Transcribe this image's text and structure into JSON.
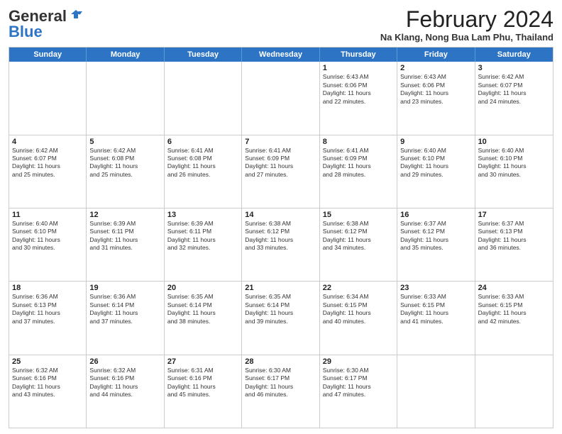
{
  "logo": {
    "general": "General",
    "blue": "Blue"
  },
  "header": {
    "title": "February 2024",
    "location": "Na Klang, Nong Bua Lam Phu, Thailand"
  },
  "weekdays": [
    "Sunday",
    "Monday",
    "Tuesday",
    "Wednesday",
    "Thursday",
    "Friday",
    "Saturday"
  ],
  "weeks": [
    [
      {
        "day": "",
        "info": ""
      },
      {
        "day": "",
        "info": ""
      },
      {
        "day": "",
        "info": ""
      },
      {
        "day": "",
        "info": ""
      },
      {
        "day": "1",
        "info": "Sunrise: 6:43 AM\nSunset: 6:06 PM\nDaylight: 11 hours\nand 22 minutes."
      },
      {
        "day": "2",
        "info": "Sunrise: 6:43 AM\nSunset: 6:06 PM\nDaylight: 11 hours\nand 23 minutes."
      },
      {
        "day": "3",
        "info": "Sunrise: 6:42 AM\nSunset: 6:07 PM\nDaylight: 11 hours\nand 24 minutes."
      }
    ],
    [
      {
        "day": "4",
        "info": "Sunrise: 6:42 AM\nSunset: 6:07 PM\nDaylight: 11 hours\nand 25 minutes."
      },
      {
        "day": "5",
        "info": "Sunrise: 6:42 AM\nSunset: 6:08 PM\nDaylight: 11 hours\nand 25 minutes."
      },
      {
        "day": "6",
        "info": "Sunrise: 6:41 AM\nSunset: 6:08 PM\nDaylight: 11 hours\nand 26 minutes."
      },
      {
        "day": "7",
        "info": "Sunrise: 6:41 AM\nSunset: 6:09 PM\nDaylight: 11 hours\nand 27 minutes."
      },
      {
        "day": "8",
        "info": "Sunrise: 6:41 AM\nSunset: 6:09 PM\nDaylight: 11 hours\nand 28 minutes."
      },
      {
        "day": "9",
        "info": "Sunrise: 6:40 AM\nSunset: 6:10 PM\nDaylight: 11 hours\nand 29 minutes."
      },
      {
        "day": "10",
        "info": "Sunrise: 6:40 AM\nSunset: 6:10 PM\nDaylight: 11 hours\nand 30 minutes."
      }
    ],
    [
      {
        "day": "11",
        "info": "Sunrise: 6:40 AM\nSunset: 6:10 PM\nDaylight: 11 hours\nand 30 minutes."
      },
      {
        "day": "12",
        "info": "Sunrise: 6:39 AM\nSunset: 6:11 PM\nDaylight: 11 hours\nand 31 minutes."
      },
      {
        "day": "13",
        "info": "Sunrise: 6:39 AM\nSunset: 6:11 PM\nDaylight: 11 hours\nand 32 minutes."
      },
      {
        "day": "14",
        "info": "Sunrise: 6:38 AM\nSunset: 6:12 PM\nDaylight: 11 hours\nand 33 minutes."
      },
      {
        "day": "15",
        "info": "Sunrise: 6:38 AM\nSunset: 6:12 PM\nDaylight: 11 hours\nand 34 minutes."
      },
      {
        "day": "16",
        "info": "Sunrise: 6:37 AM\nSunset: 6:12 PM\nDaylight: 11 hours\nand 35 minutes."
      },
      {
        "day": "17",
        "info": "Sunrise: 6:37 AM\nSunset: 6:13 PM\nDaylight: 11 hours\nand 36 minutes."
      }
    ],
    [
      {
        "day": "18",
        "info": "Sunrise: 6:36 AM\nSunset: 6:13 PM\nDaylight: 11 hours\nand 37 minutes."
      },
      {
        "day": "19",
        "info": "Sunrise: 6:36 AM\nSunset: 6:14 PM\nDaylight: 11 hours\nand 37 minutes."
      },
      {
        "day": "20",
        "info": "Sunrise: 6:35 AM\nSunset: 6:14 PM\nDaylight: 11 hours\nand 38 minutes."
      },
      {
        "day": "21",
        "info": "Sunrise: 6:35 AM\nSunset: 6:14 PM\nDaylight: 11 hours\nand 39 minutes."
      },
      {
        "day": "22",
        "info": "Sunrise: 6:34 AM\nSunset: 6:15 PM\nDaylight: 11 hours\nand 40 minutes."
      },
      {
        "day": "23",
        "info": "Sunrise: 6:33 AM\nSunset: 6:15 PM\nDaylight: 11 hours\nand 41 minutes."
      },
      {
        "day": "24",
        "info": "Sunrise: 6:33 AM\nSunset: 6:15 PM\nDaylight: 11 hours\nand 42 minutes."
      }
    ],
    [
      {
        "day": "25",
        "info": "Sunrise: 6:32 AM\nSunset: 6:16 PM\nDaylight: 11 hours\nand 43 minutes."
      },
      {
        "day": "26",
        "info": "Sunrise: 6:32 AM\nSunset: 6:16 PM\nDaylight: 11 hours\nand 44 minutes."
      },
      {
        "day": "27",
        "info": "Sunrise: 6:31 AM\nSunset: 6:16 PM\nDaylight: 11 hours\nand 45 minutes."
      },
      {
        "day": "28",
        "info": "Sunrise: 6:30 AM\nSunset: 6:17 PM\nDaylight: 11 hours\nand 46 minutes."
      },
      {
        "day": "29",
        "info": "Sunrise: 6:30 AM\nSunset: 6:17 PM\nDaylight: 11 hours\nand 47 minutes."
      },
      {
        "day": "",
        "info": ""
      },
      {
        "day": "",
        "info": ""
      }
    ]
  ]
}
